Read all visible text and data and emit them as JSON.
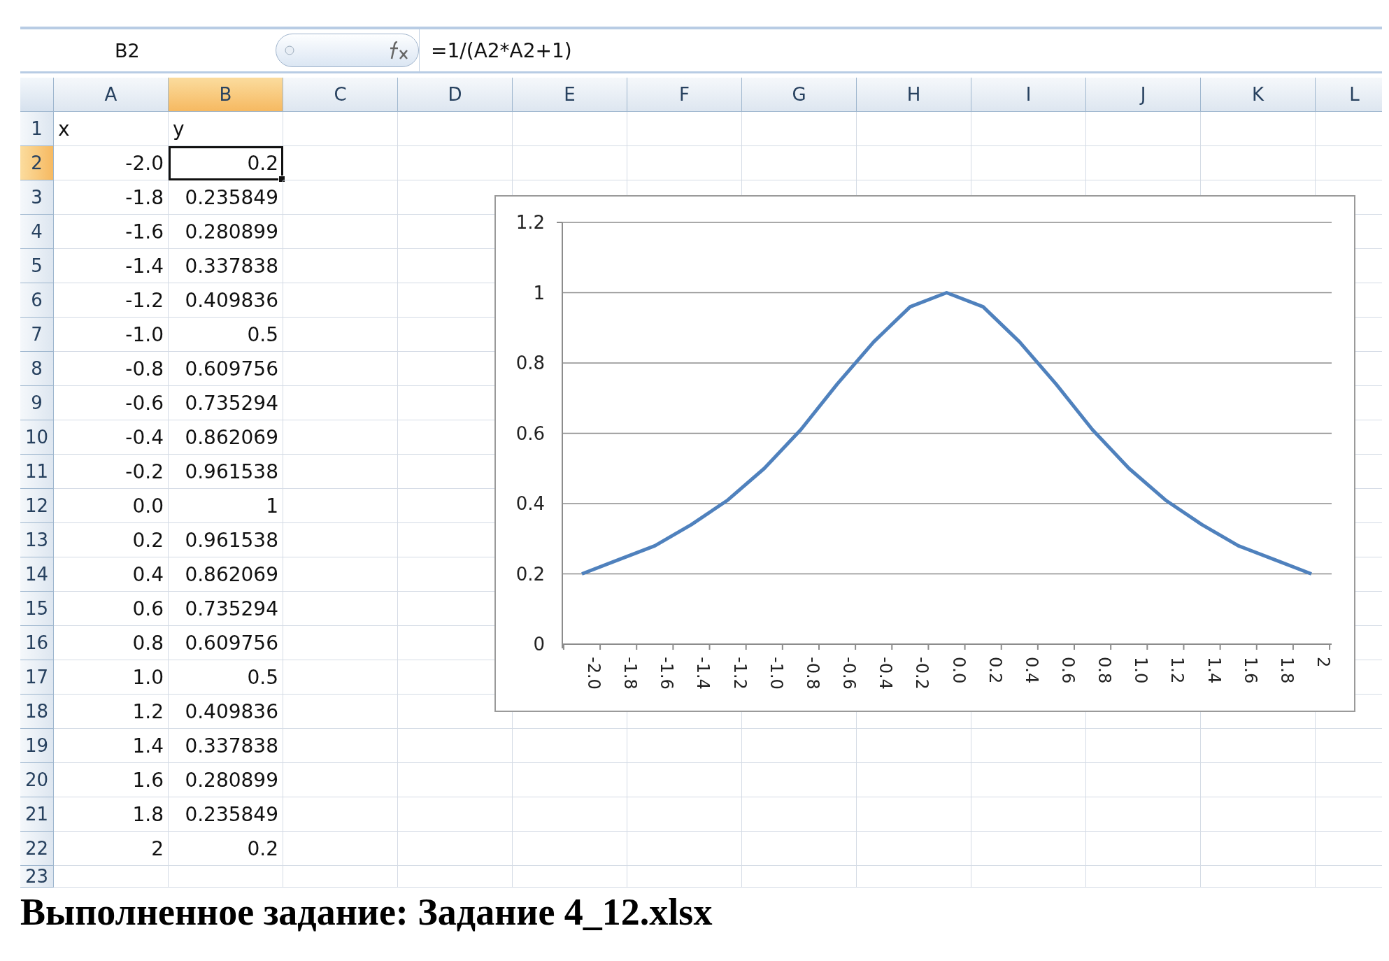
{
  "formula_bar": {
    "name_box": "B2",
    "formula": "=1/(A2*A2+1)"
  },
  "sheet": {
    "columns": [
      {
        "label": "A",
        "selected": false
      },
      {
        "label": "B",
        "selected": true
      },
      {
        "label": "C",
        "selected": false
      },
      {
        "label": "D",
        "selected": false
      },
      {
        "label": "E",
        "selected": false
      },
      {
        "label": "F",
        "selected": false
      },
      {
        "label": "G",
        "selected": false
      },
      {
        "label": "H",
        "selected": false
      },
      {
        "label": "I",
        "selected": false
      },
      {
        "label": "J",
        "selected": false
      },
      {
        "label": "K",
        "selected": false
      },
      {
        "label": "L",
        "selected": false
      }
    ],
    "rows": [
      {
        "number": "1",
        "selected": false,
        "cells": [
          {
            "text": "x",
            "kind": "text",
            "selected": false
          },
          {
            "text": "y",
            "kind": "text",
            "selected": false
          }
        ]
      },
      {
        "number": "2",
        "selected": true,
        "cells": [
          {
            "text": "-2.0",
            "kind": "number",
            "selected": false
          },
          {
            "text": "0.2",
            "kind": "number",
            "selected": true
          }
        ]
      },
      {
        "number": "3",
        "selected": false,
        "cells": [
          {
            "text": "-1.8",
            "kind": "number",
            "selected": false
          },
          {
            "text": "0.235849",
            "kind": "number",
            "selected": false
          }
        ]
      },
      {
        "number": "4",
        "selected": false,
        "cells": [
          {
            "text": "-1.6",
            "kind": "number",
            "selected": false
          },
          {
            "text": "0.280899",
            "kind": "number",
            "selected": false
          }
        ]
      },
      {
        "number": "5",
        "selected": false,
        "cells": [
          {
            "text": "-1.4",
            "kind": "number",
            "selected": false
          },
          {
            "text": "0.337838",
            "kind": "number",
            "selected": false
          }
        ]
      },
      {
        "number": "6",
        "selected": false,
        "cells": [
          {
            "text": "-1.2",
            "kind": "number",
            "selected": false
          },
          {
            "text": "0.409836",
            "kind": "number",
            "selected": false
          }
        ]
      },
      {
        "number": "7",
        "selected": false,
        "cells": [
          {
            "text": "-1.0",
            "kind": "number",
            "selected": false
          },
          {
            "text": "0.5",
            "kind": "number",
            "selected": false
          }
        ]
      },
      {
        "number": "8",
        "selected": false,
        "cells": [
          {
            "text": "-0.8",
            "kind": "number",
            "selected": false
          },
          {
            "text": "0.609756",
            "kind": "number",
            "selected": false
          }
        ]
      },
      {
        "number": "9",
        "selected": false,
        "cells": [
          {
            "text": "-0.6",
            "kind": "number",
            "selected": false
          },
          {
            "text": "0.735294",
            "kind": "number",
            "selected": false
          }
        ]
      },
      {
        "number": "10",
        "selected": false,
        "cells": [
          {
            "text": "-0.4",
            "kind": "number",
            "selected": false
          },
          {
            "text": "0.862069",
            "kind": "number",
            "selected": false
          }
        ]
      },
      {
        "number": "11",
        "selected": false,
        "cells": [
          {
            "text": "-0.2",
            "kind": "number",
            "selected": false
          },
          {
            "text": "0.961538",
            "kind": "number",
            "selected": false
          }
        ]
      },
      {
        "number": "12",
        "selected": false,
        "cells": [
          {
            "text": "0.0",
            "kind": "number",
            "selected": false
          },
          {
            "text": "1",
            "kind": "number",
            "selected": false
          }
        ]
      },
      {
        "number": "13",
        "selected": false,
        "cells": [
          {
            "text": "0.2",
            "kind": "number",
            "selected": false
          },
          {
            "text": "0.961538",
            "kind": "number",
            "selected": false
          }
        ]
      },
      {
        "number": "14",
        "selected": false,
        "cells": [
          {
            "text": "0.4",
            "kind": "number",
            "selected": false
          },
          {
            "text": "0.862069",
            "kind": "number",
            "selected": false
          }
        ]
      },
      {
        "number": "15",
        "selected": false,
        "cells": [
          {
            "text": "0.6",
            "kind": "number",
            "selected": false
          },
          {
            "text": "0.735294",
            "kind": "number",
            "selected": false
          }
        ]
      },
      {
        "number": "16",
        "selected": false,
        "cells": [
          {
            "text": "0.8",
            "kind": "number",
            "selected": false
          },
          {
            "text": "0.609756",
            "kind": "number",
            "selected": false
          }
        ]
      },
      {
        "number": "17",
        "selected": false,
        "cells": [
          {
            "text": "1.0",
            "kind": "number",
            "selected": false
          },
          {
            "text": "0.5",
            "kind": "number",
            "selected": false
          }
        ]
      },
      {
        "number": "18",
        "selected": false,
        "cells": [
          {
            "text": "1.2",
            "kind": "number",
            "selected": false
          },
          {
            "text": "0.409836",
            "kind": "number",
            "selected": false
          }
        ]
      },
      {
        "number": "19",
        "selected": false,
        "cells": [
          {
            "text": "1.4",
            "kind": "number",
            "selected": false
          },
          {
            "text": "0.337838",
            "kind": "number",
            "selected": false
          }
        ]
      },
      {
        "number": "20",
        "selected": false,
        "cells": [
          {
            "text": "1.6",
            "kind": "number",
            "selected": false
          },
          {
            "text": "0.280899",
            "kind": "number",
            "selected": false
          }
        ]
      },
      {
        "number": "21",
        "selected": false,
        "cells": [
          {
            "text": "1.8",
            "kind": "number",
            "selected": false
          },
          {
            "text": "0.235849",
            "kind": "number",
            "selected": false
          }
        ]
      },
      {
        "number": "22",
        "selected": false,
        "cells": [
          {
            "text": "2",
            "kind": "number",
            "selected": false
          },
          {
            "text": "0.2",
            "kind": "number",
            "selected": false
          }
        ]
      },
      {
        "number": "23",
        "selected": false
      }
    ],
    "chart": {
      "chart_data": {
        "type": "line",
        "categories": [
          "-2.0",
          "-1.8",
          "-1.6",
          "-1.4",
          "-1.2",
          "-1.0",
          "-0.8",
          "-0.6",
          "-0.4",
          "-0.2",
          "0.0",
          "0.2",
          "0.4",
          "0.6",
          "0.8",
          "1.0",
          "1.2",
          "1.4",
          "1.6",
          "1.8",
          "2"
        ],
        "series": [
          {
            "color": "#4f81bd",
            "values": [
              0.2,
              0.24,
              0.28,
              0.34,
              0.41,
              0.5,
              0.61,
              0.74,
              0.86,
              0.96,
              1,
              0.96,
              0.86,
              0.74,
              0.61,
              0.5,
              0.41,
              0.34,
              0.28,
              0.24,
              0.2
            ]
          }
        ],
        "grid": true,
        "ylim": [
          0,
          1.2
        ],
        "yticks": [
          0,
          0.2,
          0.4,
          0.6,
          0.8,
          1,
          1.2
        ]
      }
    }
  },
  "caption": "Выполненное задание: Задание 4_12.xlsx"
}
